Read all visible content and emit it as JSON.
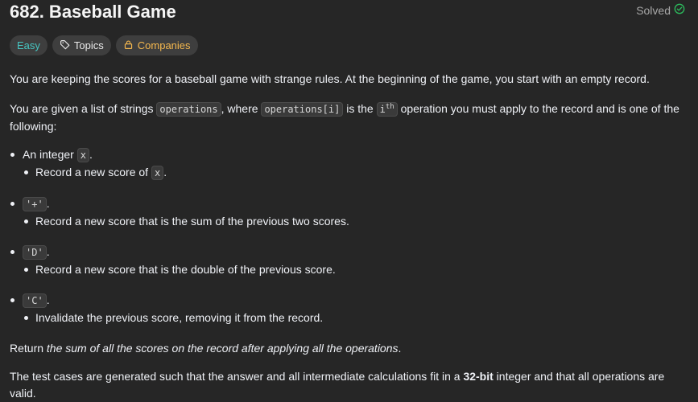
{
  "problem": {
    "title": "682. Baseball Game",
    "status": "Solved"
  },
  "tags": {
    "difficulty": "Easy",
    "topics": "Topics",
    "companies": "Companies"
  },
  "colors": {
    "easy": "#46c6c2",
    "companies": "#f5b84e",
    "solved_check": "#2cbb5d",
    "background": "#262626"
  },
  "description": {
    "p1": "You are keeping the scores for a baseball game with strange rules. At the beginning of the game, you start with an empty record.",
    "p2_a": "You are given a list of strings ",
    "p2_code1": "operations",
    "p2_b": ", where ",
    "p2_code2": "operations[i]",
    "p2_c": " is the ",
    "p2_sup_base": "i",
    "p2_sup": "th",
    "p2_d": " operation you must apply to the record and is one of the following:",
    "items": [
      {
        "head_text": "An integer ",
        "head_code": "x",
        "head_tail": ".",
        "sub_text": "Record a new score of ",
        "sub_code": "x",
        "sub_tail": "."
      },
      {
        "head_code": "'+'",
        "head_tail": ".",
        "sub_text": "Record a new score that is the sum of the previous two scores."
      },
      {
        "head_code": "'D'",
        "head_tail": ".",
        "sub_text": "Record a new score that is the double of the previous score."
      },
      {
        "head_code": "'C'",
        "head_tail": ".",
        "sub_text": "Invalidate the previous score, removing it from the record."
      }
    ],
    "p3_a": "Return ",
    "p3_em": "the sum of all the scores on the record after applying all the operations",
    "p3_b": ".",
    "p4_a": "The test cases are generated such that the answer and all intermediate calculations fit in a ",
    "p4_bold": "32-bit",
    "p4_b": " integer and that all operations are valid."
  }
}
